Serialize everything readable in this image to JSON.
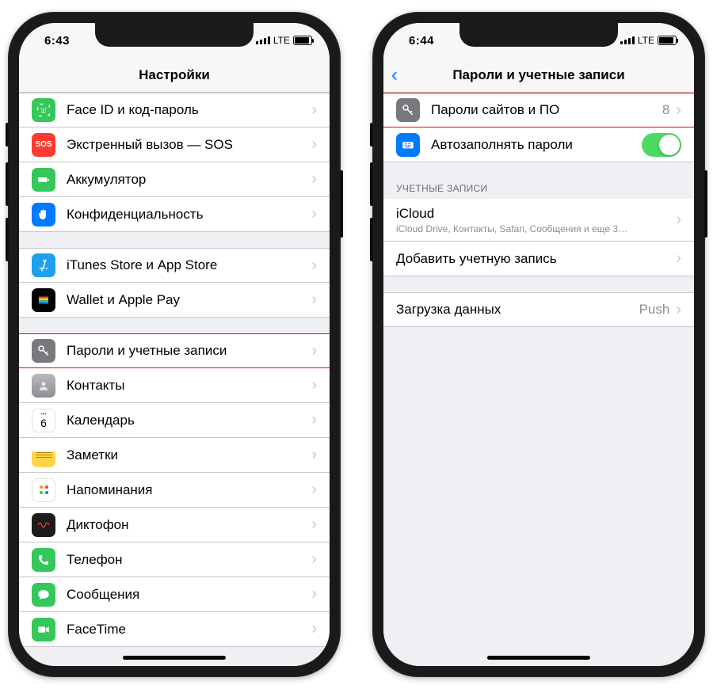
{
  "left": {
    "status": {
      "time": "6:43",
      "carrier": "LTE"
    },
    "nav": {
      "title": "Настройки"
    },
    "groups": [
      {
        "rows": [
          {
            "id": "faceid",
            "label": "Face ID и код-пароль",
            "icon": "faceid-icon"
          },
          {
            "id": "sos",
            "label": "Экстренный вызов — SOS",
            "icon": "sos-icon"
          },
          {
            "id": "battery",
            "label": "Аккумулятор",
            "icon": "battery-icon"
          },
          {
            "id": "privacy",
            "label": "Конфиденциальность",
            "icon": "privacy-hand-icon"
          }
        ]
      },
      {
        "rows": [
          {
            "id": "appstore",
            "label": "iTunes Store и App Store",
            "icon": "appstore-icon"
          },
          {
            "id": "wallet",
            "label": "Wallet и Apple Pay",
            "icon": "wallet-icon"
          }
        ]
      },
      {
        "rows": [
          {
            "id": "passwords",
            "label": "Пароли и учетные записи",
            "icon": "key-icon",
            "highlight": true
          },
          {
            "id": "contacts",
            "label": "Контакты",
            "icon": "contacts-icon"
          },
          {
            "id": "calendar",
            "label": "Календарь",
            "icon": "calendar-icon"
          },
          {
            "id": "notes",
            "label": "Заметки",
            "icon": "notes-icon"
          },
          {
            "id": "reminders",
            "label": "Напоминания",
            "icon": "reminders-icon"
          },
          {
            "id": "voice",
            "label": "Диктофон",
            "icon": "voice-memos-icon"
          },
          {
            "id": "phone",
            "label": "Телефон",
            "icon": "phone-icon"
          },
          {
            "id": "messages",
            "label": "Сообщения",
            "icon": "messages-icon"
          },
          {
            "id": "facetime",
            "label": "FaceTime",
            "icon": "facetime-icon"
          }
        ]
      }
    ]
  },
  "right": {
    "status": {
      "time": "6:44",
      "carrier": "LTE"
    },
    "nav": {
      "title": "Пароли и учетные записи",
      "back": true
    },
    "groups": [
      {
        "rows": [
          {
            "id": "site-pw",
            "label": "Пароли сайтов и ПО",
            "icon": "key-icon",
            "detail": "8",
            "chev": true,
            "highlight": true
          },
          {
            "id": "autofill",
            "label": "Автозаполнять пароли",
            "icon": "keyboard-icon",
            "toggle": true
          }
        ]
      },
      {
        "header": "УЧЕТНЫЕ ЗАПИСИ",
        "rows": [
          {
            "id": "icloud",
            "label": "iCloud",
            "sub": "iCloud Drive, Контакты, Safari, Сообщения и еще 3…",
            "chev": true
          },
          {
            "id": "add-account",
            "label": "Добавить учетную запись",
            "chev": true
          }
        ]
      },
      {
        "rows": [
          {
            "id": "fetch",
            "label": "Загрузка данных",
            "detail": "Push",
            "chev": true
          }
        ]
      }
    ]
  }
}
